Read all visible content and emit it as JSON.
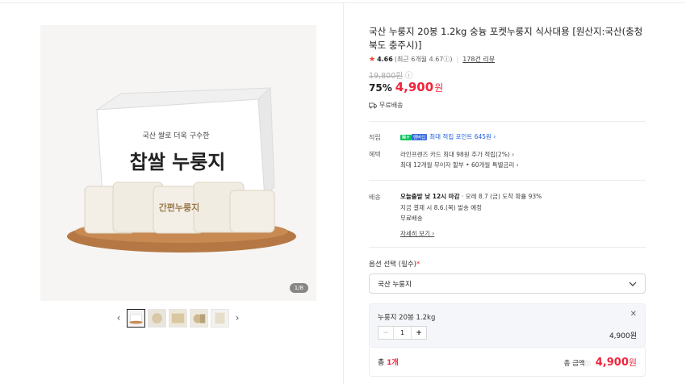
{
  "product": {
    "title": "국산 누룽지 20봉 1.2kg 숭늉 포켓누룽지 식사대용 [원산지:국산(충청북도 충주시)]",
    "rating_score": "4.66",
    "rating_sub": "(최근 6개월 4.67ⓘ)",
    "review_count": "178건 리뷰",
    "original_price": "19,800원",
    "discount": "75%",
    "price": "4,900",
    "price_unit": "원",
    "shipping_free": "무료배송"
  },
  "gallery": {
    "counter": "1/8",
    "box_text_top": "국산 쌀로 더욱 구수한",
    "box_text_main": "찹쌀 누룽지",
    "pouch_text": "간편누룽지"
  },
  "points": {
    "label": "적립",
    "badge_n": "N+",
    "badge_member": "멤버십",
    "text": "최대 적립 포인트 645원 ›"
  },
  "benefits": {
    "label": "혜택",
    "line1": "라인프렌즈 카드 최대 98원 추가 적립(2%) ›",
    "line2": "최대 12개월 무이자 할부 • 60개월 특별금리 ›"
  },
  "delivery": {
    "label": "배송",
    "line1_bold": "오늘출발 낮 12시 마감",
    "line1_rest": " · 모레 8.7 (금) 도착 확률 93%",
    "line2": "지금 결제 시 8.6.(목) 발송 예정",
    "line3": "무료배송",
    "more": "자세히 보기 ›"
  },
  "options": {
    "label": "옵션 선택 (필수)",
    "required_mark": "*",
    "selected_value": "국산 누룽지",
    "item_name": "누룽지 20봉 1.2kg",
    "quantity": "1",
    "item_price": "4,900원"
  },
  "total": {
    "count_label": "총 ",
    "count_value": "1개",
    "amount_label": "총 금액",
    "amount_info": "ⓘ",
    "amount": "4,900",
    "amount_unit": "원"
  },
  "colors": {
    "accent_red": "#f0253b",
    "link_blue": "#1d5de0",
    "npay_green": "#03c75a"
  }
}
